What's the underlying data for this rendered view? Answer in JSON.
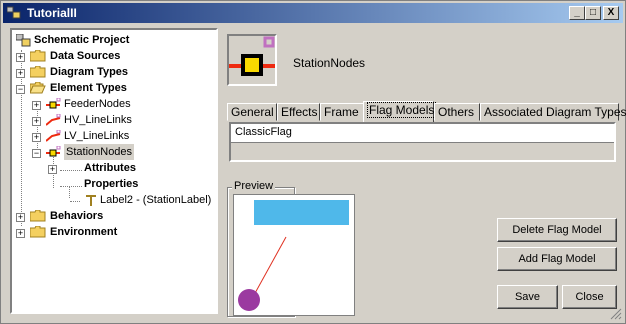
{
  "window": {
    "title": "TutorialII",
    "controls": {
      "minimize": "_",
      "maximize": "□",
      "close": "X"
    }
  },
  "tree": {
    "items": [
      {
        "label": "Schematic Project",
        "icon": "project-icon"
      },
      {
        "label": "Data Sources",
        "icon": "folder-icon"
      },
      {
        "label": "Diagram Types",
        "icon": "folder-icon"
      },
      {
        "label": "Element Types",
        "icon": "folder-open-icon"
      },
      {
        "label": "FeederNodes",
        "icon": "node-icon"
      },
      {
        "label": "HV_LineLinks",
        "icon": "link-icon"
      },
      {
        "label": "LV_LineLinks",
        "icon": "link-icon"
      },
      {
        "label": "StationNodes",
        "icon": "node-icon"
      },
      {
        "label": "Attributes",
        "icon": ""
      },
      {
        "label": "Properties",
        "icon": ""
      },
      {
        "label": "Label2 - (StationLabel)",
        "icon": "text-label-icon"
      },
      {
        "label": "Behaviors",
        "icon": "folder-icon"
      },
      {
        "label": "Environment",
        "icon": "folder-icon"
      }
    ]
  },
  "detail": {
    "element_name": "StationNodes",
    "tabs": [
      {
        "label": "General"
      },
      {
        "label": "Effects"
      },
      {
        "label": "Frame"
      },
      {
        "label": "Flag Models"
      },
      {
        "label": "Others"
      },
      {
        "label": "Associated Diagram Types"
      }
    ],
    "flag_models": [
      "ClassicFlag"
    ],
    "preview_label": "Preview"
  },
  "buttons": {
    "delete_flag_model": "Delete Flag Model",
    "add_flag_model": "Add Flag Model",
    "save": "Save",
    "close": "Close"
  },
  "colors": {
    "titlebar_start": "#0a246a",
    "titlebar_end": "#a6caf0",
    "flag_rect": "#4fb8ea",
    "flag_circle": "#9b3aa0",
    "flag_line": "#e03020",
    "node_red": "#ee2a10",
    "node_yellow": "#f8d800",
    "node_accent": "#c070c0"
  }
}
